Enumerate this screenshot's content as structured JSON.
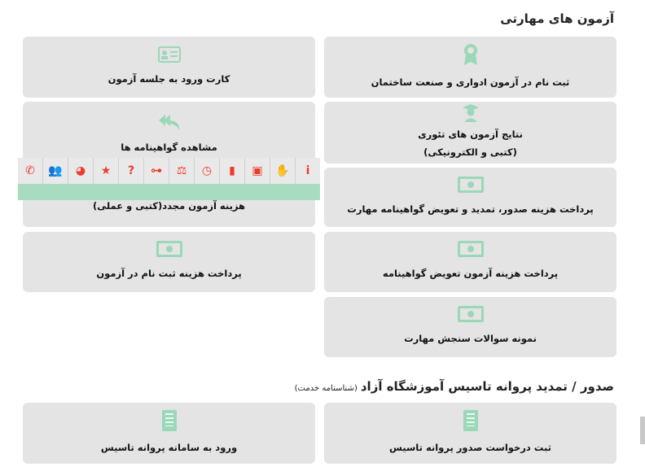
{
  "sections": {
    "skill_exams_title": "آزمون های مهارتی",
    "license_title": "صدور / تمدید پروانه تاسیس آموزشگاه آزاد",
    "license_subtitle": "(شناسنامه خدمت)"
  },
  "cards": {
    "register_exam": "ثبت نام در آزمون ادواری و صنعت ساختمان",
    "entry_card": "کارت ورود به جلسه آزمون",
    "theory_results_l1": "نتایج آزمون های تئوری",
    "theory_results_l2": "(کتبی و الکترونیکی)",
    "view_certificates": "مشاهده گواهینامه ها",
    "pay_issue_renew": "پرداخت هزینه صدور، تمدید و تعویض گواهینامه مهارت",
    "retake_fee": "هزینه آزمون مجدد(کتبی و عملی)",
    "pay_replace_exam": "پرداخت هزینه آزمون تعویض گواهینامه",
    "pay_register_fee": "پرداخت هزینه ثبت نام در آزمون",
    "sample_questions": "نمونه سوالات سنجش مهارت",
    "request_license": "ثبت درخواست صدور پروانه تاسیس",
    "license_portal": "ورود به سامانه پروانه تاسیس"
  },
  "toolbar": {
    "buttons": [
      {
        "icon": "phone-icon",
        "glyph": "✆"
      },
      {
        "icon": "people-icon",
        "glyph": "👥"
      },
      {
        "icon": "pie-chart-icon",
        "glyph": "◕"
      },
      {
        "icon": "star-icon",
        "glyph": "★"
      },
      {
        "icon": "question-icon",
        "glyph": "?"
      },
      {
        "icon": "sitemap-icon",
        "glyph": "⊶"
      },
      {
        "icon": "scales-icon",
        "glyph": "⚖"
      },
      {
        "icon": "clock-icon",
        "glyph": "◷"
      },
      {
        "icon": "document-icon",
        "glyph": "▮"
      },
      {
        "icon": "money-icon",
        "glyph": "▣"
      },
      {
        "icon": "handshake-icon",
        "glyph": "✋"
      },
      {
        "icon": "info-icon",
        "glyph": "i"
      }
    ]
  },
  "colors": {
    "card_bg": "#e4e4e4",
    "icon_green": "#9ad8b7",
    "toolbar_red": "#ee3b2a",
    "toolbar_band": "#a8dcc0"
  }
}
